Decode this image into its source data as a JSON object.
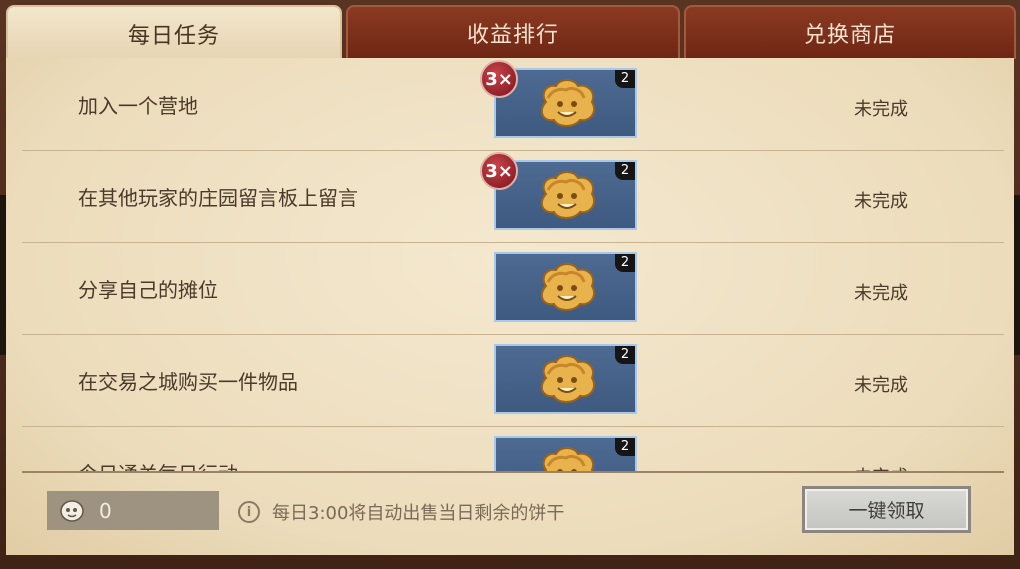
{
  "tabs": [
    {
      "label": "每日任务",
      "active": true
    },
    {
      "label": "收益排行",
      "active": false
    },
    {
      "label": "兑换商店",
      "active": false
    }
  ],
  "tasks": [
    {
      "name": "加入一个营地",
      "status": "未完成",
      "reward_qty": "2",
      "multiplier": "3×"
    },
    {
      "name": "在其他玩家的庄园留言板上留言",
      "status": "未完成",
      "reward_qty": "2",
      "multiplier": "3×"
    },
    {
      "name": "分享自己的摊位",
      "status": "未完成",
      "reward_qty": "2",
      "multiplier": ""
    },
    {
      "name": "在交易之城购买一件物品",
      "status": "未完成",
      "reward_qty": "2",
      "multiplier": ""
    },
    {
      "name": "今日通关每日行动",
      "status": "未完成",
      "reward_qty": "2",
      "multiplier": ""
    }
  ],
  "footer": {
    "coin_count": "0",
    "info_text": "每日3:00将自动出售当日剩余的饼干",
    "claim_label": "一键领取"
  },
  "icons": {
    "cookie": "cookie-icon",
    "coin": "cookie-coin-icon",
    "info": "info-icon"
  },
  "colors": {
    "tab_inactive": "#7a2e18",
    "tab_active": "#efe2c6",
    "reward_bg": "#46628a",
    "multiplier_badge": "#a22a31"
  }
}
